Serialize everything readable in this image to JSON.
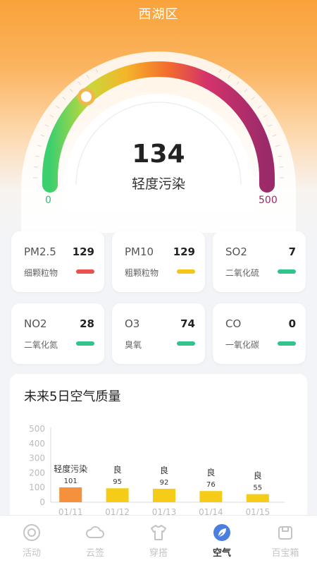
{
  "header": {
    "title": "西湖区"
  },
  "gauge": {
    "value": "134",
    "level": "轻度污染",
    "min": "0",
    "max": "500",
    "fraction": 0.268
  },
  "pollutants": [
    {
      "name": "PM2.5",
      "value": "129",
      "desc": "细颗粒物",
      "color": "#e8524a"
    },
    {
      "name": "PM10",
      "value": "129",
      "desc": "粗颗粒物",
      "color": "#f5c518"
    },
    {
      "name": "SO2",
      "value": "7",
      "desc": "二氧化硫",
      "color": "#2fc48a"
    },
    {
      "name": "NO2",
      "value": "28",
      "desc": "二氧化氮",
      "color": "#2fc48a"
    },
    {
      "name": "O3",
      "value": "74",
      "desc": "臭氧",
      "color": "#2fc48a"
    },
    {
      "name": "CO",
      "value": "0",
      "desc": "一氧化碳",
      "color": "#2fc48a"
    }
  ],
  "forecast": {
    "title": "未来5日空气质量",
    "chart_data": {
      "type": "bar",
      "categories": [
        "01/11",
        "01/12",
        "01/13",
        "01/14",
        "01/15"
      ],
      "values": [
        101,
        95,
        92,
        76,
        55
      ],
      "labels": [
        "轻度污染",
        "良",
        "良",
        "良",
        "良"
      ],
      "colors": [
        "#f5913d",
        "#f5cc18",
        "#f5cc18",
        "#f5cc18",
        "#f5cc18"
      ],
      "yticks": [
        "0",
        "100",
        "200",
        "300",
        "400",
        "500"
      ],
      "ylim": [
        0,
        500
      ],
      "title": "",
      "xlabel": "",
      "ylabel": ""
    }
  },
  "tabs": [
    {
      "label": "活动",
      "icon": "activity-icon",
      "active": false
    },
    {
      "label": "云签",
      "icon": "cloud-icon",
      "active": false
    },
    {
      "label": "穿搭",
      "icon": "shirt-icon",
      "active": false
    },
    {
      "label": "空气",
      "icon": "leaf-icon",
      "active": true
    },
    {
      "label": "百宝箱",
      "icon": "box-icon",
      "active": false
    }
  ]
}
